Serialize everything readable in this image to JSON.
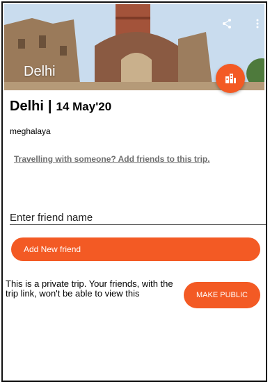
{
  "header": {
    "title": "Delhi",
    "share_icon": "share-icon",
    "more_icon": "more-vert-icon",
    "fab_icon": "city-buildings-icon",
    "accent_color": "#f35a24"
  },
  "trip": {
    "city": "Delhi",
    "separator": "|",
    "date": "14 May'20",
    "description": "meghalaya",
    "add_friends_link": "Travelling with someone? Add friends to this trip."
  },
  "friend_form": {
    "placeholder": "Enter friend name",
    "add_button_label": "Add New friend"
  },
  "privacy": {
    "note": "This is a private trip. Your friends, with the trip link, won't be able to view this",
    "make_public_label": "MAKE PUBLIC"
  }
}
